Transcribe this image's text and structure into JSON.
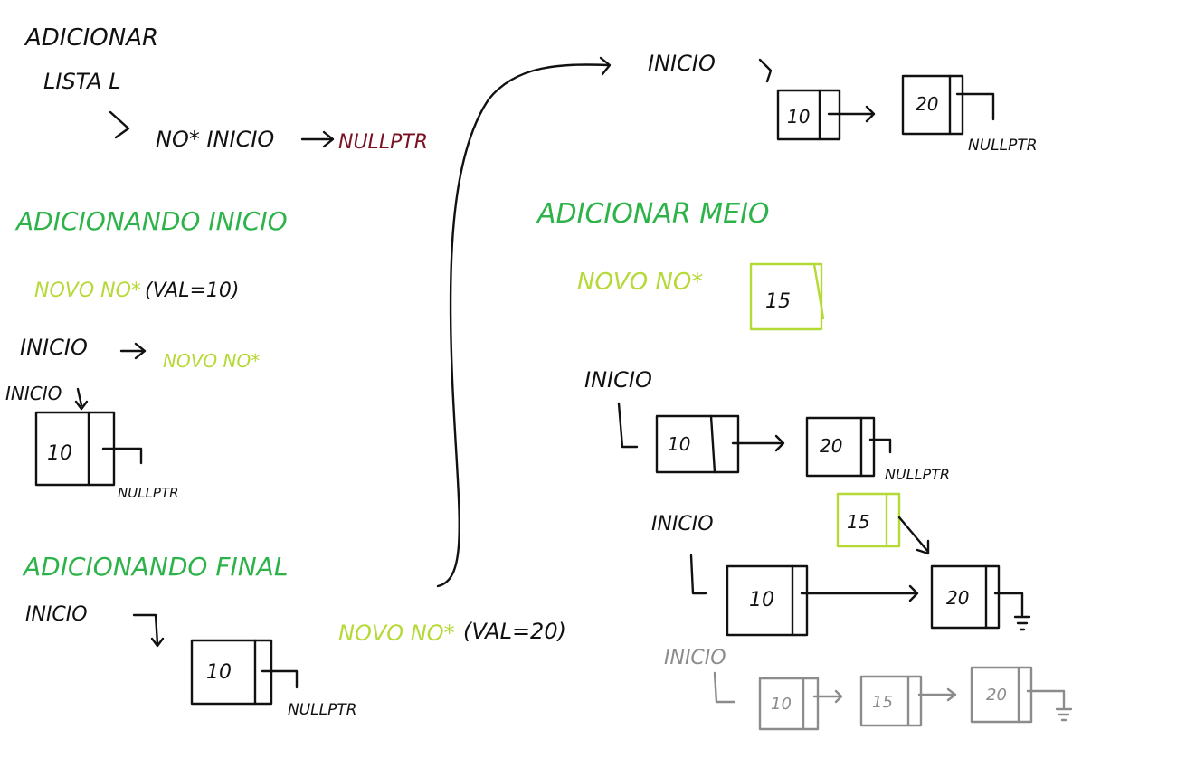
{
  "colors": {
    "ink": "#111111",
    "green": "#2db34a",
    "lime": "#b5d936",
    "dark_red": "#7a1022",
    "gray": "#8c8c8c"
  },
  "header": {
    "title": "ADICIONAR",
    "lista": "LISTA L",
    "no_inicio": "NO* INICIO",
    "nullptr": "NULLPTR"
  },
  "inicio_section": {
    "title": "ADICIONANDO INICIO",
    "novo_no": "NOVO NO*",
    "val": "(VAL=10)",
    "inicio_label": "INICIO",
    "arrow_target": "NOVO NO*",
    "inicio_label2": "INICIO",
    "node_value": "10",
    "nullptr": "NULLPTR"
  },
  "final_section": {
    "title": "ADICIONANDO FINAL",
    "inicio_label": "INICIO",
    "node_value": "10",
    "nullptr": "NULLPTR",
    "novo_no": "NOVO NO*",
    "val": "(VAL=20)"
  },
  "top_right": {
    "inicio_label": "INICIO",
    "node1": "10",
    "node2": "20",
    "nullptr": "NULLPTR"
  },
  "meio_section": {
    "title": "ADICIONAR MEIO",
    "novo_no": "NOVO NO*",
    "new_node": "15",
    "step1": {
      "inicio_label": "INICIO",
      "node1": "10",
      "node2": "20",
      "nullptr": "NULLPTR"
    },
    "step2": {
      "inicio_label": "INICIO",
      "new_node": "15",
      "node1": "10",
      "node2": "20"
    },
    "step3": {
      "inicio_label": "INICIO",
      "node1": "10",
      "node2": "15",
      "node3": "20"
    }
  }
}
